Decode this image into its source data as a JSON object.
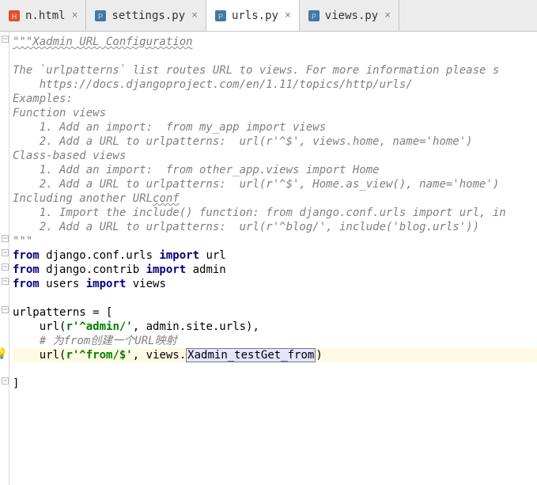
{
  "tabs": [
    {
      "label": "n.html",
      "icon_color": "#e44d26",
      "active": false
    },
    {
      "label": "settings.py",
      "icon_color": "#3776ab",
      "active": false
    },
    {
      "label": "urls.py",
      "icon_color": "#3776ab",
      "active": true
    },
    {
      "label": "views.py",
      "icon_color": "#3776ab",
      "active": false
    }
  ],
  "code": {
    "doc_title": "\"\"\"Xadmin URL Configuration",
    "doc_blank1": "",
    "doc_l1": "The `urlpatterns` list routes URL to views. For more information please s",
    "doc_l2": "    https://docs.djangoproject.com/en/1.11/topics/http/urls/",
    "doc_l3": "Examples:",
    "doc_l4": "Function views",
    "doc_l5": "    1. Add an import:  from my_app import views",
    "doc_l6": "    2. Add a URL to urlpatterns:  url(r'^$', views.home, name='home')",
    "doc_l7": "Class-based views",
    "doc_l8": "    1. Add an import:  from other_app.views import Home",
    "doc_l9": "    2. Add a URL to urlpatterns:  url(r'^$', Home.as_view(), name='home')",
    "doc_l10": "Including another URLconf",
    "doc_l11": "    1. Import the include() function: from django.conf.urls import url, in",
    "doc_l12": "    2. Add a URL to urlpatterns:  url(r'^blog/', include('blog.urls'))",
    "doc_end": "\"\"\"",
    "from_kw": "from",
    "import_kw": "import",
    "imp1_mod": " django.conf.urls ",
    "imp1_name": " url",
    "imp2_mod": " django.contrib ",
    "imp2_name": " admin",
    "imp3_mod": " users ",
    "imp3_name": " views",
    "blank": "",
    "urlpatterns_open": "urlpatterns = [",
    "line_url1_a": "    url(",
    "line_url1_str": "r'^admin/'",
    "line_url1_b": ", admin.site.urls),",
    "line_comment": "    # 为from创建一个URL映射",
    "line_url2_a": "    url(",
    "line_url2_str": "r'^from/$'",
    "line_url2_b": ", views.",
    "line_url2_ident": "Xadmin_testGet_from",
    "line_url2_c": ")",
    "close_bracket": "]"
  }
}
